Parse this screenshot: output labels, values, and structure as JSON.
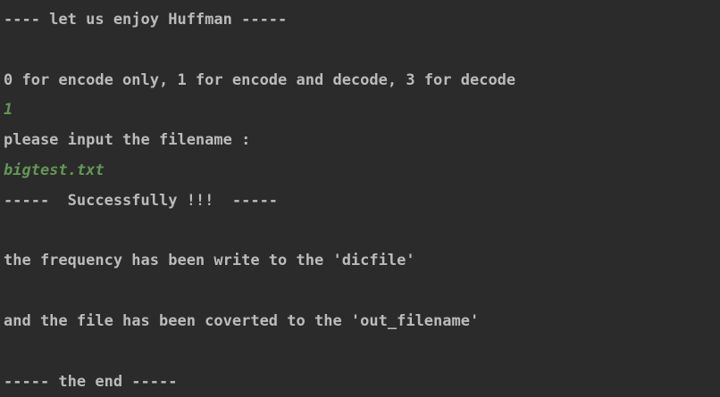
{
  "console": {
    "lines": [
      {
        "text": "---- let us enjoy Huffman -----",
        "kind": "output"
      },
      {
        "text": "",
        "kind": "blank"
      },
      {
        "text": "0 for encode only, 1 for encode and decode, 3 for decode",
        "kind": "output"
      },
      {
        "text": "1",
        "kind": "input"
      },
      {
        "text": "please input the filename :",
        "kind": "output"
      },
      {
        "text": "bigtest.txt",
        "kind": "input"
      },
      {
        "text": "-----  Successfully !!!  -----",
        "kind": "output"
      },
      {
        "text": "",
        "kind": "blank"
      },
      {
        "text": "the frequency has been write to the 'dicfile'",
        "kind": "output"
      },
      {
        "text": "",
        "kind": "blank"
      },
      {
        "text": "and the file has been coverted to the 'out_filename'",
        "kind": "output"
      },
      {
        "text": "",
        "kind": "blank"
      },
      {
        "text": "----- the end -----",
        "kind": "output"
      }
    ]
  },
  "colors": {
    "background": "#2b2b2b",
    "output_text": "#bbbbbb",
    "user_input_text": "#629755"
  }
}
